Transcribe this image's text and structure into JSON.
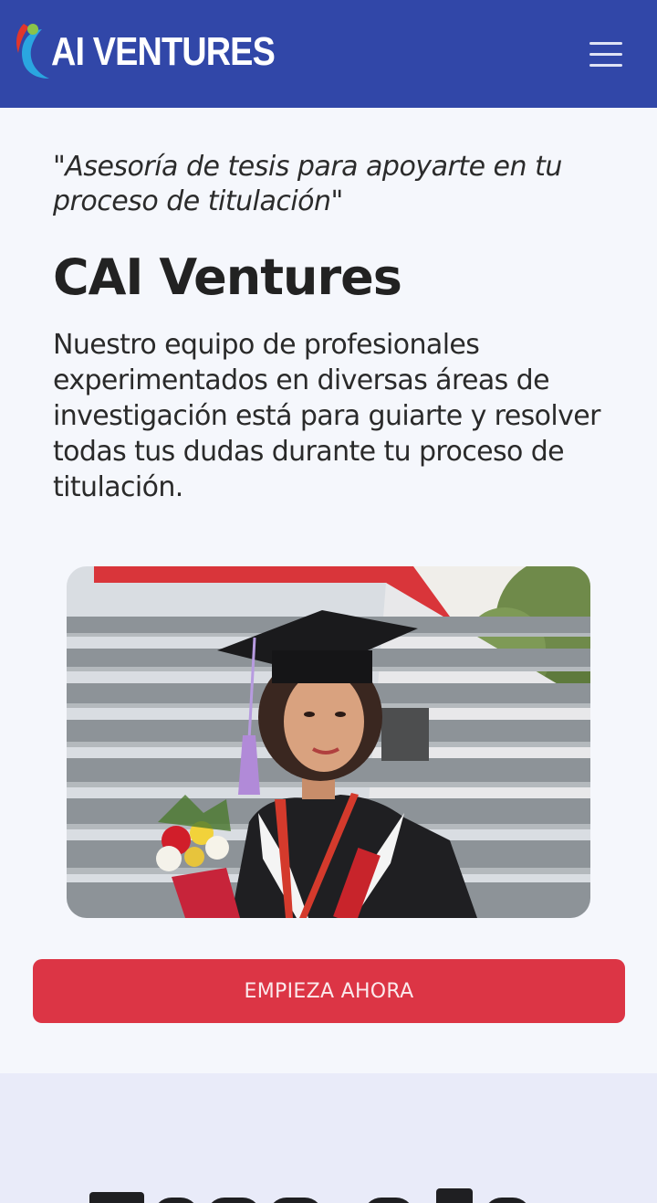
{
  "navbar": {
    "logo_text": "AI VENTURES",
    "logo_icon": "cai-logo-icon",
    "menu_icon": "hamburger-menu-icon",
    "background": "#3147a8"
  },
  "hero": {
    "quote": "\"Asesoría de tesis para apoyarte en tu proceso de titulación\"",
    "title": "CAI Ventures",
    "description": "Nuestro equipo de profesionales experimentados en diversas áreas de investigación está para guiarte y resolver todas tus dudas durante tu proceso de titulación.",
    "cta_label": "EMPIEZA AHORA",
    "cta_color": "#dc3545"
  },
  "next_section": {
    "background": "#e9ebf9"
  }
}
